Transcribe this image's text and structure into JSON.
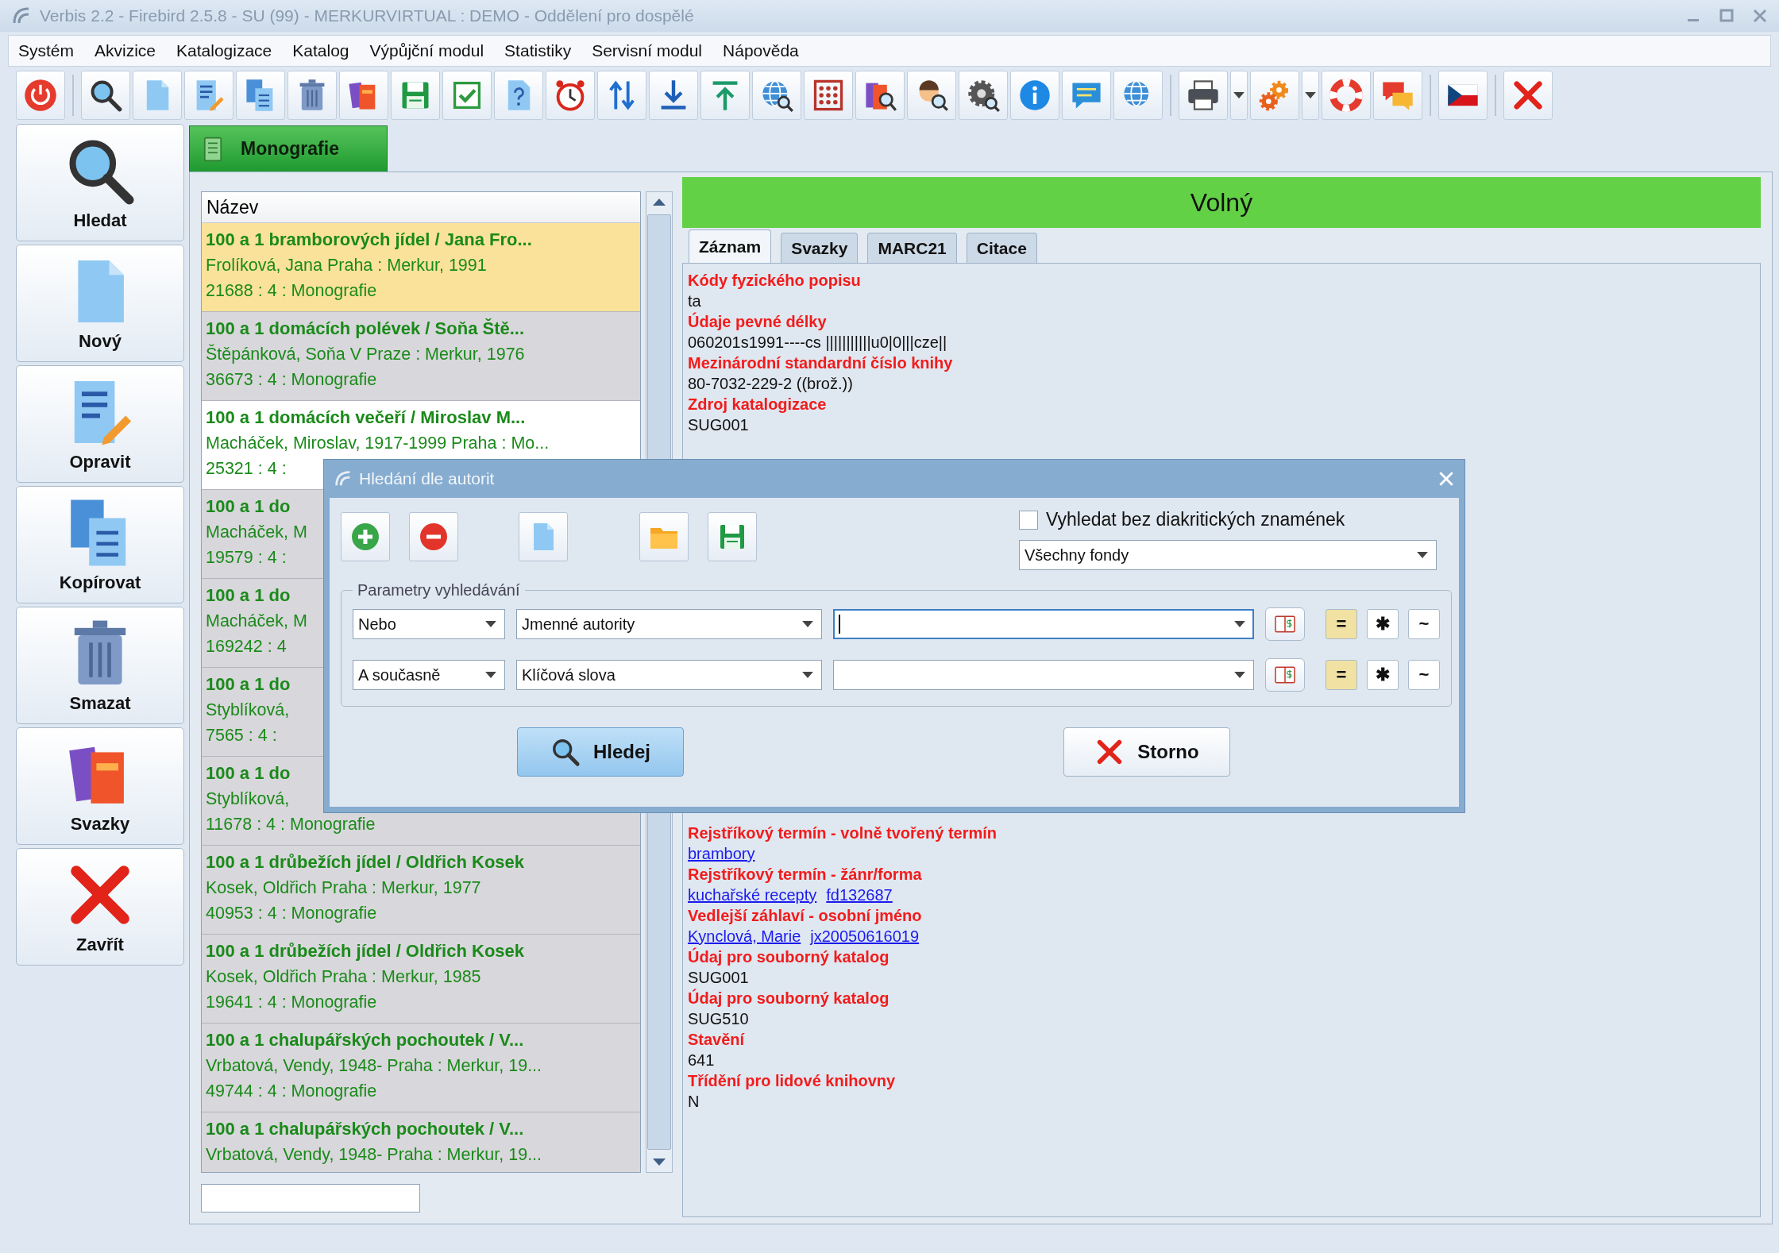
{
  "window": {
    "title": "Verbis 2.2 - Firebird 2.5.8 - SU (99) - MERKURVIRTUAL : DEMO - Oddělení pro dospělé"
  },
  "menu": [
    "Systém",
    "Akvizice",
    "Katalogizace",
    "Katalog",
    "Výpůjční modul",
    "Statistiky",
    "Servisní modul",
    "Nápověda"
  ],
  "sidebar": [
    {
      "label": "Hledat",
      "kind": "search"
    },
    {
      "label": "Nový",
      "kind": "new"
    },
    {
      "label": "Opravit",
      "kind": "edit"
    },
    {
      "label": "Kopírovat",
      "kind": "copy"
    },
    {
      "label": "Smazat",
      "kind": "delete"
    },
    {
      "label": "Svazky",
      "kind": "volumes"
    },
    {
      "label": "Zavřít",
      "kind": "close"
    }
  ],
  "document_tab": {
    "label": "Monografie"
  },
  "list": {
    "header": "Název",
    "rows": [
      {
        "title": "100 a 1 bramborových jídel / Jana Fro...",
        "line_2": "Frolíková, Jana Praha : Merkur, 1991",
        "line_3": "21688 : 4 : Monografie",
        "selected": true,
        "highlighted": false
      },
      {
        "title": "100 a 1 domácích polévek / Soňa Ště...",
        "line_2": "Štěpánková, Soňa V Praze : Merkur, 1976",
        "line_3": "36673 : 4 : Monografie",
        "selected": false,
        "highlighted": false
      },
      {
        "title": "100 a 1 domácích večeří / Miroslav M...",
        "line_2": "Macháček, Miroslav, 1917-1999 Praha : Mo...",
        "line_3": "25321 : 4 :",
        "selected": false,
        "highlighted": true
      },
      {
        "title": "100 a 1 do",
        "line_2": "Macháček, M",
        "line_3": "19579 : 4 :",
        "selected": false,
        "highlighted": false
      },
      {
        "title": "100 a 1 do",
        "line_2": "Macháček, M",
        "line_3": "169242 : 4",
        "selected": false,
        "highlighted": false
      },
      {
        "title": "100 a 1 do",
        "line_2": "Styblíková,",
        "line_3": "7565 : 4 :",
        "selected": false,
        "highlighted": false
      },
      {
        "title": "100 a 1 do",
        "line_2": "Styblíková,",
        "line_3": "11678 : 4 : Monografie",
        "selected": false,
        "highlighted": false
      },
      {
        "title": "100 a 1 drůbežích jídel / Oldřich Kosek",
        "line_2": "Kosek, Oldřich Praha : Merkur, 1977",
        "line_3": "40953 : 4 : Monografie",
        "selected": false,
        "highlighted": false
      },
      {
        "title": "100 a 1 drůbežích jídel / Oldřich Kosek",
        "line_2": "Kosek, Oldřich Praha : Merkur, 1985",
        "line_3": "19641 : 4 : Monografie",
        "selected": false,
        "highlighted": false
      },
      {
        "title": "100 a 1 chalupářských pochoutek / V...",
        "line_2": "Vrbatová, Vendy, 1948- Praha : Merkur, 19...",
        "line_3": "49744 : 4 : Monografie",
        "selected": false,
        "highlighted": false
      },
      {
        "title": "100 a 1 chalupářských pochoutek / V...",
        "line_2": "Vrbatová, Vendy, 1948- Praha : Merkur, 19...",
        "selected": false,
        "highlighted": false
      }
    ]
  },
  "status": "Volný",
  "record_tabs": [
    {
      "label": "Záznam",
      "selected": true
    },
    {
      "label": "Svazky",
      "selected": false
    },
    {
      "label": "MARC21",
      "selected": false
    },
    {
      "label": "Citace",
      "selected": false
    }
  ],
  "record_fields_above": [
    {
      "label": "Kódy fyzického popisu",
      "values": [
        "ta"
      ],
      "linked": false
    },
    {
      "label": "Údaje pevné délky",
      "values": [
        "060201s1991----cs |||||||||||u0|0|||cze||"
      ],
      "linked": false
    },
    {
      "label": "Mezinárodní standardní číslo knihy",
      "values": [
        "80-7032-229-2 ((brož.))"
      ],
      "linked": false
    },
    {
      "label": "Zdroj katalogizace",
      "values": [
        "SUG001"
      ],
      "linked": false
    }
  ],
  "record_fields_below": [
    {
      "label": "Rejstříkový termín - volně tvořený termín",
      "values": [
        "brambory"
      ],
      "linked": true
    },
    {
      "label": "Rejstříkový termín - žánr/forma",
      "values": [
        "kuchařské recepty",
        "fd132687"
      ],
      "linked": true
    },
    {
      "label": "Vedlejší záhlaví - osobní jméno",
      "values": [
        "Kynclová, Marie",
        "jx20050616019"
      ],
      "linked": true
    },
    {
      "label": "Údaj pro souborný katalog",
      "values": [
        "SUG001"
      ],
      "linked": false
    },
    {
      "label": "Údaj pro souborný katalog",
      "values": [
        "SUG510"
      ],
      "linked": false
    },
    {
      "label": "Stavění",
      "values": [
        "641"
      ],
      "linked": false
    },
    {
      "label": "Třídění pro lidové knihovny",
      "values": [
        "N"
      ],
      "linked": false
    }
  ],
  "dialog": {
    "title": "Hledání dle autorit",
    "no_diacritics": {
      "label": "Vyhledat bez diakritických znamének",
      "checked": false
    },
    "fund_select": "Všechny fondy",
    "group_label": "Parametry vyhledávání",
    "rows": [
      {
        "operator": "Nebo",
        "field": "Jmenné autority",
        "focused": true,
        "modes": [
          {
            "symbol": "=",
            "selected": true
          },
          {
            "symbol": "✱",
            "selected": false
          },
          {
            "symbol": "~",
            "selected": false
          }
        ]
      },
      {
        "operator": "A současně",
        "field": "Klíčová slova",
        "focused": false,
        "modes": [
          {
            "symbol": "=",
            "selected": true
          },
          {
            "symbol": "✱",
            "selected": false
          },
          {
            "symbol": "~",
            "selected": false
          }
        ]
      }
    ],
    "buttons": [
      {
        "label": "Hledej",
        "kind": "search",
        "default": true
      },
      {
        "label": "Storno",
        "kind": "cancel",
        "default": false
      }
    ]
  }
}
